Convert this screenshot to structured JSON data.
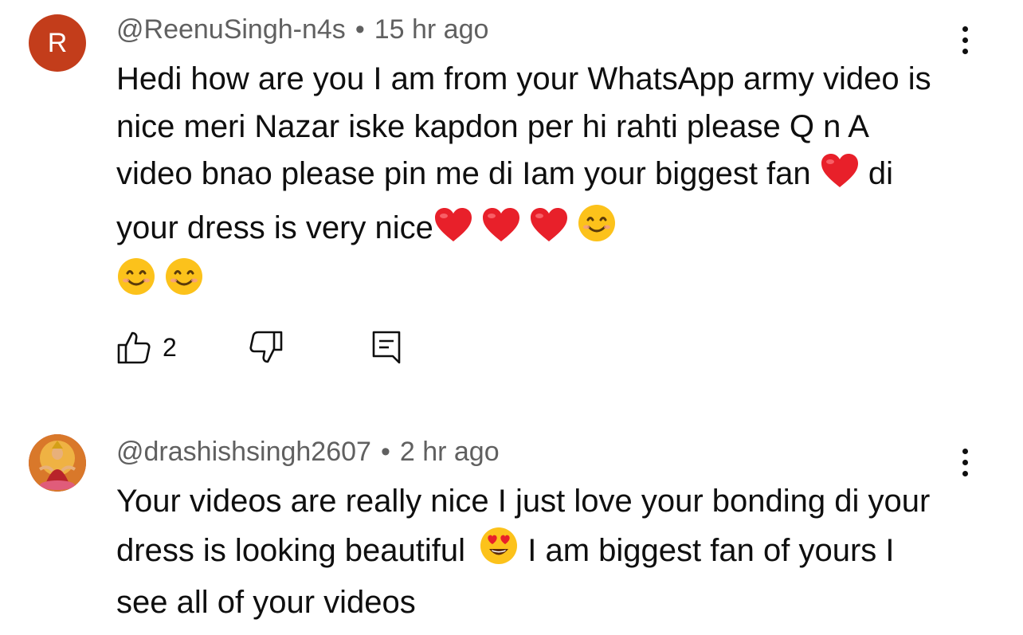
{
  "comments": [
    {
      "avatar_letter": "R",
      "avatar_color": "#c33d1b",
      "author": "@ReenuSingh-n4s",
      "time": "15 hr ago",
      "text_parts": [
        "Hedi how are you I am from your WhatsApp army video is nice meri Nazar iske kapdon per hi rahti please Q n A video bnao please pin me di Iam your biggest fan ",
        " di your dress is very nice"
      ],
      "emojis": [
        "heart",
        "heart",
        "heart",
        "heart",
        "smile",
        "smile",
        "smile"
      ],
      "like_count": "2",
      "icons": {
        "like": "thumbs-up-icon",
        "dislike": "thumbs-down-icon",
        "reply": "reply-icon",
        "more": "more-vert-icon"
      }
    },
    {
      "avatar_description": "image",
      "author": "@drashishsingh2607",
      "time": "2 hr ago",
      "text_parts": [
        "Your videos are really nice I just love your bonding di your dress is looking beautiful ",
        "  I am biggest fan of yours I see all of your videos"
      ],
      "emojis": [
        "heart-eyes"
      ],
      "icons": {
        "more": "more-vert-icon"
      }
    }
  ],
  "separator": "•"
}
